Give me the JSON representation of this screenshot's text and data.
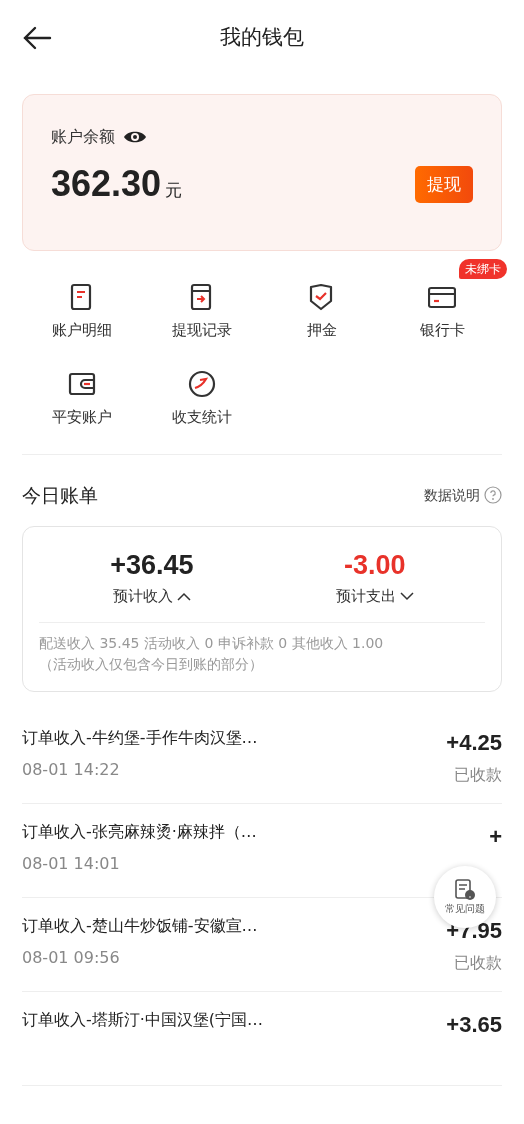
{
  "header": {
    "title": "我的钱包"
  },
  "balance": {
    "label": "账户余额",
    "amount": "362.30",
    "unit": "元",
    "button": "提现"
  },
  "shortcuts": [
    {
      "kind": "detail",
      "label": "账户明细"
    },
    {
      "kind": "withdraw",
      "label": "提现记录"
    },
    {
      "kind": "deposit",
      "label": "押金"
    },
    {
      "kind": "card",
      "label": "银行卡",
      "badge": "未绑卡"
    },
    {
      "kind": "wallet",
      "label": "平安账户"
    },
    {
      "kind": "stats",
      "label": "收支统计"
    }
  ],
  "today": {
    "title": "今日账单",
    "help": "数据说明",
    "income": {
      "amount": "+36.45",
      "label": "预计收入",
      "expanded": true
    },
    "expense": {
      "amount": "-3.00",
      "label": "预计支出",
      "expanded": false
    },
    "breakdown": "配送收入 35.45 活动收入 0 申诉补款 0 其他收入 1.00",
    "note": "（活动收入仅包含今日到账的部分）"
  },
  "transactions": [
    {
      "title": "订单收入-牛约堡-手作牛肉汉堡…",
      "time": "08-01 14:22",
      "amount": "+4.25",
      "status": "已收款"
    },
    {
      "title": "订单收入-张亮麻辣烫·麻辣拌（…",
      "time": "08-01 14:01",
      "amount": "+"
    },
    {
      "title": "订单收入-楚山牛炒饭铺-安徽宣…",
      "time": "08-01 09:56",
      "amount": "+7.95",
      "status": "已收款"
    },
    {
      "title": "订单收入-塔斯汀·中国汉堡(宁国…",
      "amount": "+3.65"
    }
  ],
  "faq": {
    "label": "常见问题"
  }
}
